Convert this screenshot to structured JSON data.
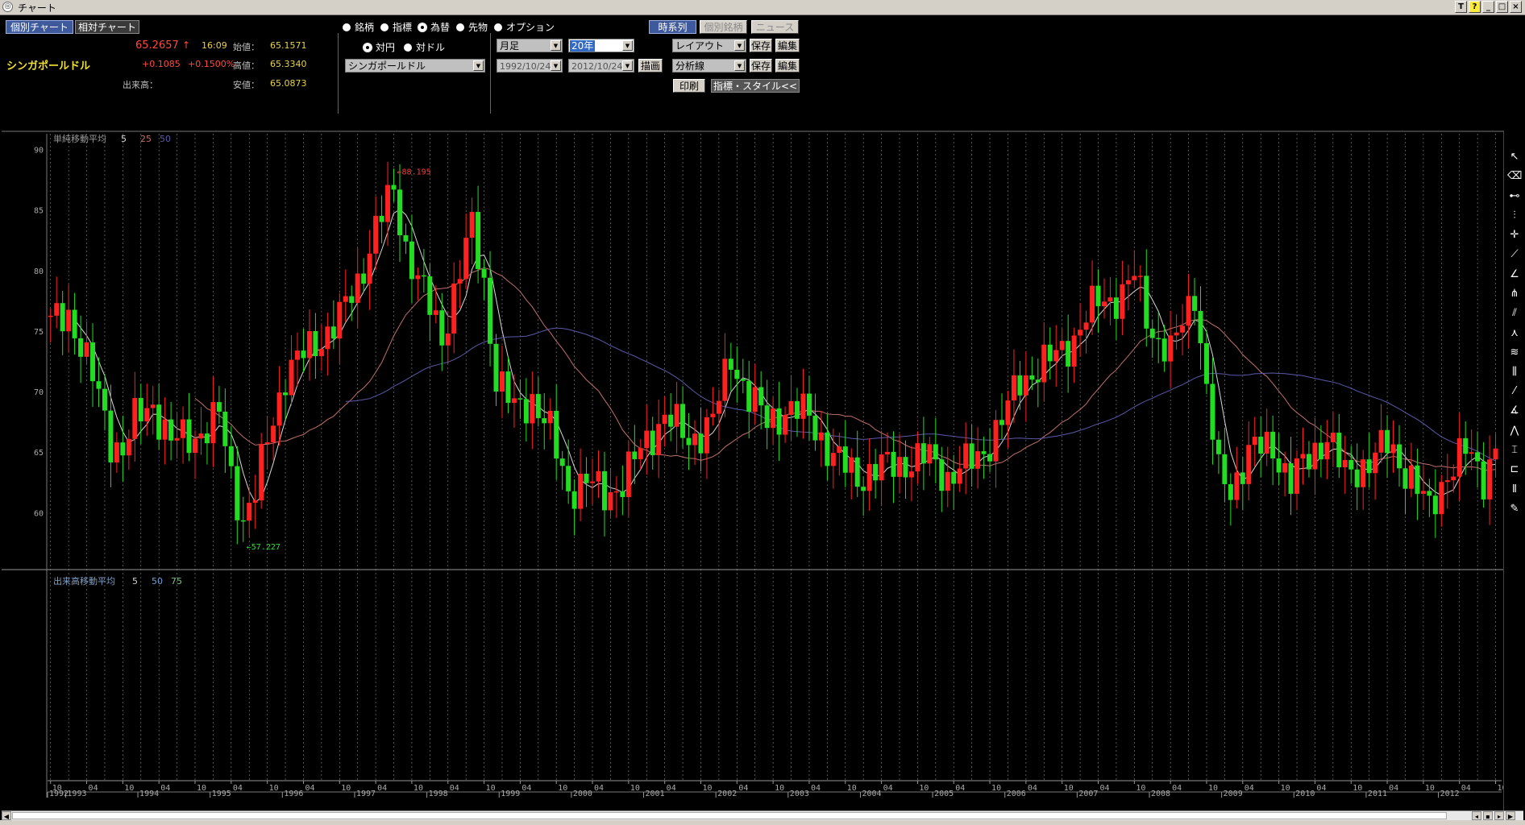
{
  "window": {
    "title": "チャート",
    "icon_glyph": "◎",
    "btn_t": "T",
    "btn_help": "?",
    "btn_min": "_",
    "btn_max": "□",
    "btn_close": "×"
  },
  "panel": {
    "tab_single": "個別チャート",
    "tab_relative": "相対チャート",
    "price": "65.2657",
    "arrow": "↑",
    "time": "16:09",
    "open_label": "始値：",
    "open_value": "65.1571",
    "instrument_name": "シンガポールドル",
    "change": "+0.1085",
    "change_pct": "+0.1500%",
    "high_label": "高値：",
    "high_value": "65.3340",
    "volume_label": "出来高：",
    "low_label": "安値：",
    "low_value": "65.0873",
    "radio_stock": "銘柄",
    "radio_index": "指標",
    "radio_fx": "為替",
    "radio_futures": "先物",
    "radio_option": "オプション",
    "radio_vs_yen": "対円",
    "radio_vs_usd": "対ドル",
    "currency_select": "シンガポールドル",
    "period_select": "月足",
    "span_select": "20年",
    "date_from": "1992/10/24",
    "date_to": "2012/10/24",
    "draw_button": "描画",
    "timeseries_button": "時系列",
    "individual_button": "個別銘柄",
    "news_button": "ニュース",
    "layout_select": "レイアウト",
    "save1": "保存",
    "edit1": "編集",
    "analysis_select": "分析線",
    "save2": "保存",
    "edit2": "編集",
    "print_button": "印刷",
    "style_button": "指標・スタイル<<"
  },
  "chart_data": {
    "type": "candlestick",
    "main_legend": {
      "title": "単純移動平均",
      "periods": [
        "5",
        "25",
        "50"
      ]
    },
    "volume_legend": {
      "title": "出来高移動平均",
      "periods": [
        "5",
        "50",
        "75"
      ]
    },
    "y_ticks": [
      "90",
      "85",
      "80",
      "75",
      "70",
      "65",
      "60"
    ],
    "ylim": [
      55.3,
      91.3
    ],
    "annot_high": "←88.195",
    "annot_low": "←57.227",
    "annot_high_value": 88.195,
    "annot_low_value": 57.227,
    "x_years": [
      "1992",
      "1993",
      "1994",
      "1995",
      "1996",
      "1997",
      "1998",
      "1999",
      "2000",
      "2001",
      "2002",
      "2003",
      "2004",
      "2005",
      "2006",
      "2007",
      "2008",
      "2009",
      "2010",
      "2011",
      "2012"
    ],
    "x_months": [
      "10",
      "04",
      "10"
    ],
    "anchors": [
      [
        "1992-10",
        75.5
      ],
      [
        "1993-01",
        76.5
      ],
      [
        "1993-03",
        74.0
      ],
      [
        "1993-06",
        69.5
      ],
      [
        "1993-08",
        66.0
      ],
      [
        "1993-10",
        65.2
      ],
      [
        "1993-12",
        67.5
      ],
      [
        "1994-03",
        69.0
      ],
      [
        "1994-06",
        65.8
      ],
      [
        "1994-09",
        66.2
      ],
      [
        "1994-12",
        67.0
      ],
      [
        "1995-02",
        68.0
      ],
      [
        "1995-04",
        63.0
      ],
      [
        "1995-06",
        59.5
      ],
      [
        "1995-08",
        61.5
      ],
      [
        "1995-10",
        66.0
      ],
      [
        "1996-01",
        71.5
      ],
      [
        "1996-06",
        74.0
      ],
      [
        "1996-10",
        76.0
      ],
      [
        "1997-01",
        79.0
      ],
      [
        "1997-04",
        83.5
      ],
      [
        "1997-07",
        86.5
      ],
      [
        "1997-09",
        82.0
      ],
      [
        "1997-12",
        78.0
      ],
      [
        "1998-03",
        74.5
      ],
      [
        "1998-06",
        80.0
      ],
      [
        "1998-08",
        83.5
      ],
      [
        "1998-10",
        79.0
      ],
      [
        "1998-12",
        71.0
      ],
      [
        "1999-03",
        68.5
      ],
      [
        "1999-06",
        69.5
      ],
      [
        "1999-09",
        66.5
      ],
      [
        "1999-12",
        62.0
      ],
      [
        "2000-03",
        62.5
      ],
      [
        "2000-06",
        61.5
      ],
      [
        "2000-09",
        62.5
      ],
      [
        "2001-01",
        66.0
      ],
      [
        "2001-04",
        68.0
      ],
      [
        "2001-08",
        66.0
      ],
      [
        "2001-12",
        67.5
      ],
      [
        "2002-03",
        73.0
      ],
      [
        "2002-06",
        69.5
      ],
      [
        "2002-09",
        67.5
      ],
      [
        "2002-12",
        68.5
      ],
      [
        "2003-04",
        68.0
      ],
      [
        "2003-08",
        64.5
      ],
      [
        "2003-12",
        63.0
      ],
      [
        "2004-06",
        64.0
      ],
      [
        "2004-12",
        64.5
      ],
      [
        "2005-03",
        63.0
      ],
      [
        "2005-08",
        64.5
      ],
      [
        "2005-12",
        67.5
      ],
      [
        "2006-03",
        71.0
      ],
      [
        "2006-08",
        72.5
      ],
      [
        "2006-12",
        74.5
      ],
      [
        "2007-04",
        77.5
      ],
      [
        "2007-08",
        78.0
      ],
      [
        "2007-10",
        79.5
      ],
      [
        "2008-01",
        75.0
      ],
      [
        "2008-04",
        73.0
      ],
      [
        "2008-08",
        78.5
      ],
      [
        "2008-10",
        70.0
      ],
      [
        "2008-12",
        63.0
      ],
      [
        "2009-02",
        62.0
      ],
      [
        "2009-05",
        65.0
      ],
      [
        "2009-09",
        65.5
      ],
      [
        "2009-12",
        62.5
      ],
      [
        "2010-03",
        64.5
      ],
      [
        "2010-06",
        66.5
      ],
      [
        "2010-09",
        63.0
      ],
      [
        "2010-12",
        64.0
      ],
      [
        "2011-04",
        65.5
      ],
      [
        "2011-08",
        63.0
      ],
      [
        "2011-11",
        60.0
      ],
      [
        "2012-02",
        63.5
      ],
      [
        "2012-05",
        65.0
      ],
      [
        "2012-08",
        63.0
      ],
      [
        "2012-10",
        65.3
      ]
    ],
    "colors": {
      "up": "#ff2020",
      "down": "#22dd22",
      "ma5": "#d8d8d8",
      "ma25": "#c0716c",
      "ma50": "#5a5aa8",
      "grid": "#ffffff",
      "axis_text": "#aaaaaa"
    }
  }
}
